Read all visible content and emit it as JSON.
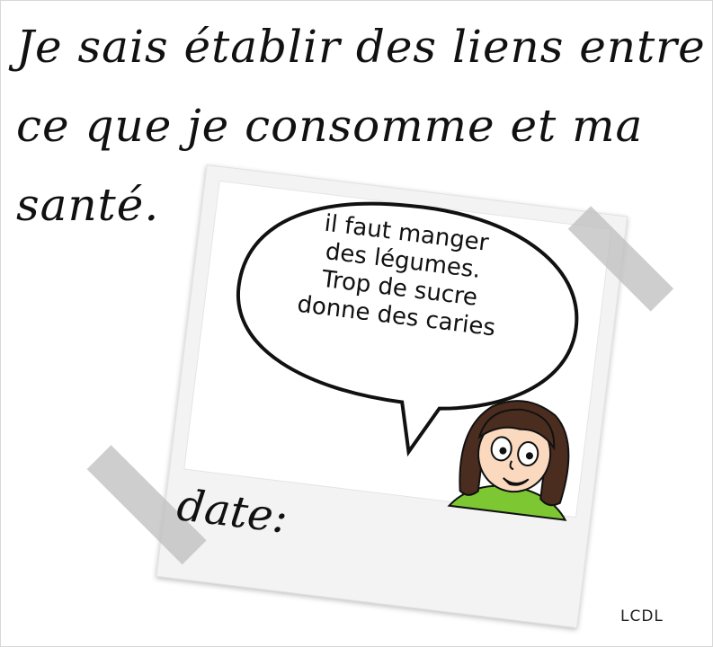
{
  "heading": {
    "line1": "Je sais établir des liens entre",
    "line2": "ce que je consomme et ma",
    "line3": "santé."
  },
  "speech": {
    "line1": "il faut manger",
    "line2": "des légumes.",
    "line3": "Trop de sucre",
    "line4": "donne des caries"
  },
  "date_label": "date:",
  "credit": "LCDL",
  "colors": {
    "text": "#111111",
    "tape": "#bebebe",
    "shirt": "#7dc832",
    "hair": "#4a2d1f",
    "skin": "#fbd9bf"
  }
}
